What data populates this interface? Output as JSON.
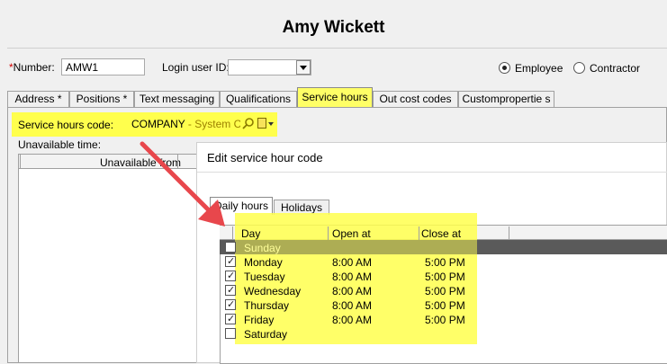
{
  "header": {
    "title": "Amy Wickett"
  },
  "form": {
    "number_label": "Number:",
    "number_required_mark": "*",
    "number_value": "AMW1",
    "login_label": "Login user ID:",
    "login_value": "",
    "employee_label": "Employee",
    "contractor_label": "Contractor",
    "selected_type": "Employee"
  },
  "tabs": [
    {
      "label": "Address *"
    },
    {
      "label": "Positions *"
    },
    {
      "label": "Text messaging"
    },
    {
      "label": "Qualifications"
    },
    {
      "label": "Service hours",
      "active": true
    },
    {
      "label": "Out cost codes"
    },
    {
      "label": "Custompropertie s"
    }
  ],
  "service_hours": {
    "code_label": "Service hours code:",
    "code_value": "COMPANY",
    "code_desc": " - System Comp",
    "unavailable_label": "Unavailable time:",
    "unavailable_col": "Unavailable from"
  },
  "dialog": {
    "title": "Edit service hour code",
    "tabs": [
      {
        "label": "Daily hours",
        "active": true
      },
      {
        "label": "Holidays"
      }
    ],
    "columns": [
      "Day",
      "Open at",
      "Close at"
    ],
    "rows": [
      {
        "day": "Sunday",
        "open": "",
        "close": "",
        "checked": false,
        "selected": true
      },
      {
        "day": "Monday",
        "open": "8:00 AM",
        "close": "5:00 PM",
        "checked": true
      },
      {
        "day": "Tuesday",
        "open": "8:00 AM",
        "close": "5:00 PM",
        "checked": true
      },
      {
        "day": "Wednesday",
        "open": "8:00 AM",
        "close": "5:00 PM",
        "checked": true
      },
      {
        "day": "Thursday",
        "open": "8:00 AM",
        "close": "5:00 PM",
        "checked": true
      },
      {
        "day": "Friday",
        "open": "8:00 AM",
        "close": "5:00 PM",
        "checked": true
      },
      {
        "day": "Saturday",
        "open": "",
        "close": "",
        "checked": false
      }
    ]
  },
  "colors": {
    "highlight": "#ffff4d",
    "arrow": "#e8474c",
    "selected_row": "#5a5a5a"
  }
}
